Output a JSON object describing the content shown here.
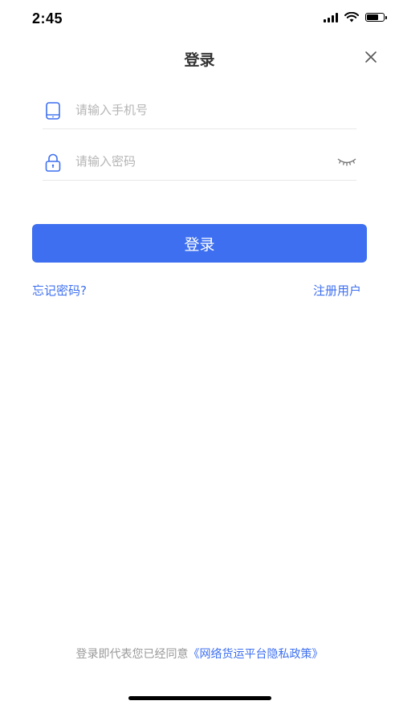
{
  "status_bar": {
    "time": "2:45"
  },
  "nav": {
    "title": "登录"
  },
  "phone_field": {
    "placeholder": "请输入手机号",
    "value": ""
  },
  "password_field": {
    "placeholder": "请输入密码",
    "value": ""
  },
  "login_button": {
    "label": "登录"
  },
  "links": {
    "forgot_password": "忘记密码?",
    "register": "注册用户"
  },
  "agreement": {
    "prefix": "登录即代表您已经同意",
    "policy_link": "《网络货运平台隐私政策》"
  },
  "colors": {
    "accent": "#3d6ff0",
    "placeholder": "#b5b5b5",
    "divider": "#e8e8e8"
  },
  "icons": [
    "signal-icon",
    "wifi-icon",
    "battery-icon",
    "close-icon",
    "phone-icon",
    "lock-icon",
    "eye-closed-icon"
  ]
}
